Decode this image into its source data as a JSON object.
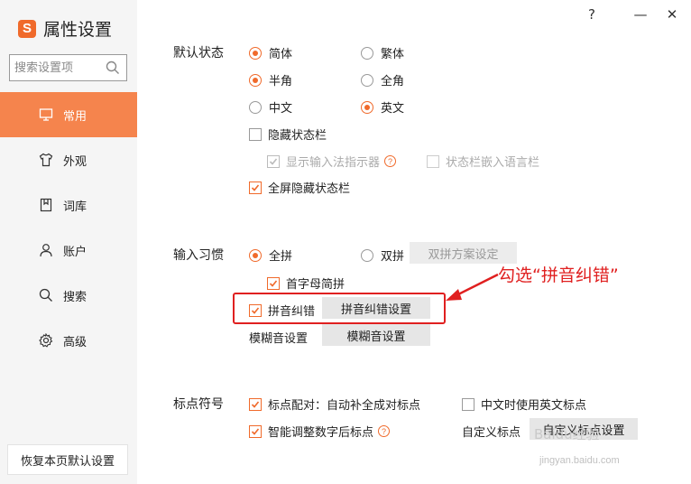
{
  "app": {
    "logo": "S",
    "title": "属性设置"
  },
  "window": {
    "help": "?",
    "minimize": "—",
    "close": "✕"
  },
  "search": {
    "placeholder": "搜索设置项"
  },
  "nav": [
    {
      "label": "常用",
      "icon": "monitor-icon",
      "active": true
    },
    {
      "label": "外观",
      "icon": "shirt-icon",
      "active": false
    },
    {
      "label": "词库",
      "icon": "book-icon",
      "active": false
    },
    {
      "label": "账户",
      "icon": "user-icon",
      "active": false
    },
    {
      "label": "搜索",
      "icon": "search-icon",
      "active": false
    },
    {
      "label": "高级",
      "icon": "gear-icon",
      "active": false
    }
  ],
  "restore_label": "恢复本页默认设置",
  "default_state": {
    "label": "默认状态",
    "simplified": "简体",
    "traditional": "繁体",
    "half_width": "半角",
    "full_width": "全角",
    "chinese": "中文",
    "english": "英文",
    "hide_status_bar": "隐藏状态栏",
    "show_indicator": "显示输入法指示器",
    "embed_language_bar": "状态栏嵌入语言栏",
    "fullscreen_hide": "全屏隐藏状态栏"
  },
  "input_habit": {
    "label": "输入习惯",
    "full_pinyin": "全拼",
    "double_pinyin": "双拼",
    "double_pinyin_settings": "双拼方案设定",
    "initial_abbrev": "首字母简拼",
    "pinyin_correction": "拼音纠错",
    "pinyin_correction_settings": "拼音纠错设置",
    "fuzzy_label": "模糊音设置",
    "fuzzy_settings": "模糊音设置"
  },
  "punctuation": {
    "label": "标点符号",
    "auto_pair": "标点配对：自动补全成对标点",
    "english_punct": "中文时使用英文标点",
    "smart_number": "智能调整数字后标点",
    "custom_label": "自定义标点",
    "custom_settings": "自定义标点设置"
  },
  "annotation": {
    "text": "勾选“拼音纠错”"
  },
  "watermark": {
    "text": "Baidu经验",
    "url": "jingyan.baidu.com"
  },
  "colors": {
    "accent": "#f06a2b",
    "nav_active": "#f5844d",
    "annotation": "#e02020"
  }
}
